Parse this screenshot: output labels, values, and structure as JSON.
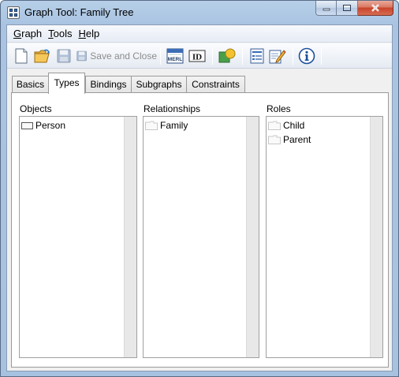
{
  "window": {
    "title": "Graph Tool: Family Tree",
    "controls": [
      "minimize-icon",
      "maximize-icon",
      "close-icon"
    ]
  },
  "menu": {
    "items": [
      {
        "label": "Graph",
        "mnemonic": "G"
      },
      {
        "label": "Tools",
        "mnemonic": "T"
      },
      {
        "label": "Help",
        "mnemonic": "H"
      }
    ]
  },
  "toolbar": {
    "new_icon": "new-document-icon",
    "open_icon": "open-folder-icon",
    "save_icon": "save-icon",
    "save_close_label": "Save and Close",
    "merl_badge": "MERL",
    "id_badge": "ID",
    "info_icon": "info-icon"
  },
  "tabs": {
    "items": [
      "Basics",
      "Types",
      "Bindings",
      "Subgraphs",
      "Constraints"
    ],
    "active": "Types"
  },
  "types": {
    "objects": {
      "label": "Objects",
      "items": [
        "Person"
      ]
    },
    "relationships": {
      "label": "Relationships",
      "items": [
        "Family"
      ]
    },
    "roles": {
      "label": "Roles",
      "items": [
        "Child",
        "Parent"
      ]
    }
  },
  "colors": {
    "title_gradient_top": "#b7cfe8",
    "close_button": "#c8432a",
    "panel_bg": "#f0f0f0",
    "disabled_text": "#8c8c8c"
  }
}
